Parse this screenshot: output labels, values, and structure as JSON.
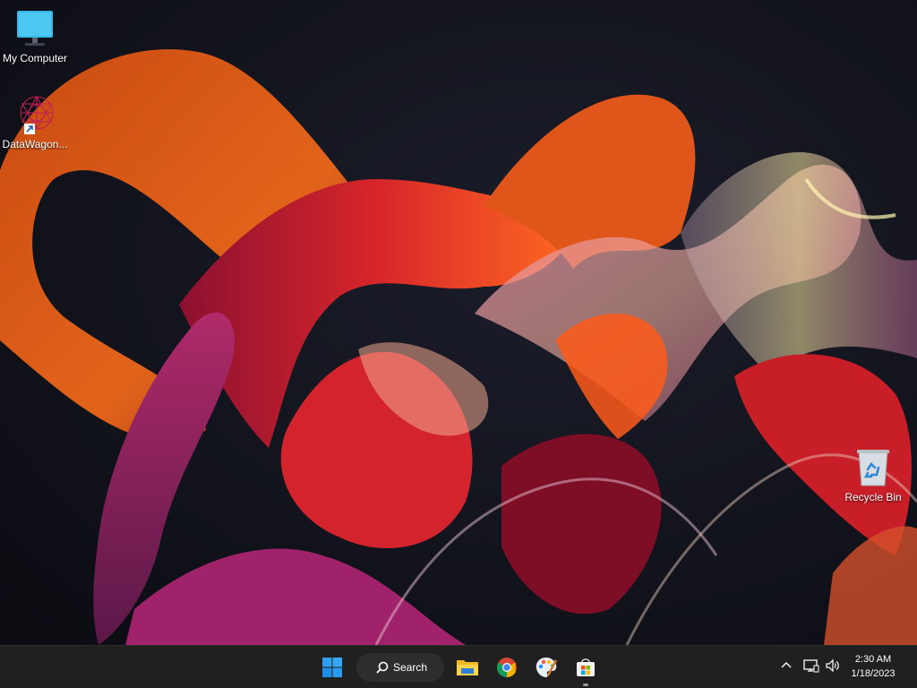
{
  "desktop": {
    "icons": [
      {
        "label": "My Computer",
        "icon": "monitor-icon"
      },
      {
        "label": "DataWagon...",
        "icon": "datawagon-app-icon"
      },
      {
        "label": "Recycle Bin",
        "icon": "recycle-bin-icon"
      }
    ]
  },
  "taskbar": {
    "search_label": "Search",
    "apps": [
      "start-button",
      "file-explorer",
      "chrome",
      "paint",
      "microsoft-store"
    ],
    "clock": {
      "time": "2:30 AM",
      "date": "1/18/2023"
    }
  }
}
